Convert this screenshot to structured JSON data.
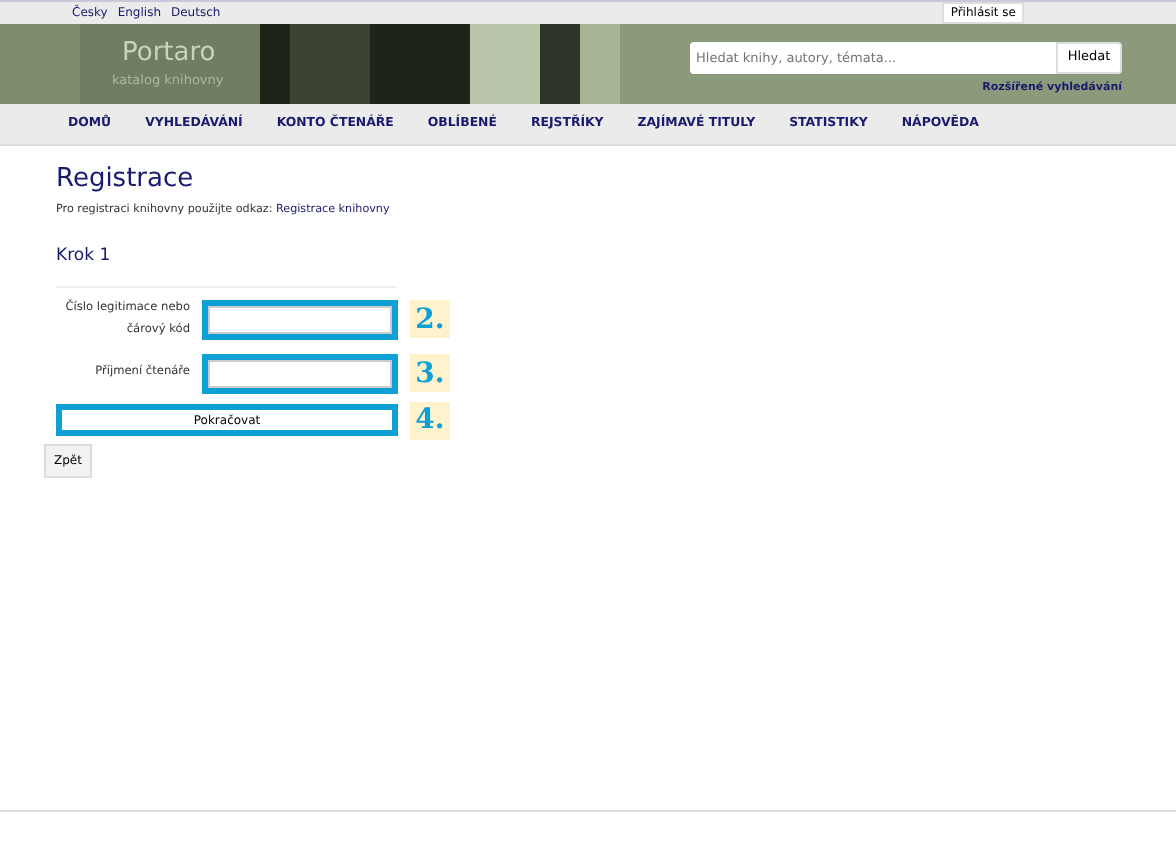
{
  "languages": [
    {
      "label": "Česky"
    },
    {
      "label": "English"
    },
    {
      "label": "Deutsch"
    }
  ],
  "login": "Přihlásit se",
  "header": {
    "logo": "Portaro",
    "subtitle": "katalog knihovny",
    "search": {
      "placeholder": "Hledat knihy, autory, témata..."
    },
    "search_button": "Hledat",
    "advanced_link": "Rozšířené vyhledávání"
  },
  "nav": [
    {
      "label": "DOMŮ"
    },
    {
      "label": "VYHLEDÁVÁNÍ"
    },
    {
      "label": "KONTO ČTENÁŘE"
    },
    {
      "label": "OBLÍBENÉ"
    },
    {
      "label": "REJSTŘÍKY"
    },
    {
      "label": "ZAJÍMAVÉ TITULY"
    },
    {
      "label": "STATISTIKY"
    },
    {
      "label": "NÁPOVĚDA"
    }
  ],
  "page": {
    "title": "Registrace",
    "intro": "Pro registraci knihovny použijte odkaz:",
    "intro_link": "Registrace knihovny",
    "step": "Krok 1",
    "fields": [
      {
        "label": "Číslo legitimace nebo čárový kód",
        "marker": "2."
      },
      {
        "label": "Příjmení čtenáře",
        "marker": "3."
      }
    ],
    "submit": {
      "label": "Pokračovat",
      "marker": "4."
    },
    "back": "Zpět"
  }
}
